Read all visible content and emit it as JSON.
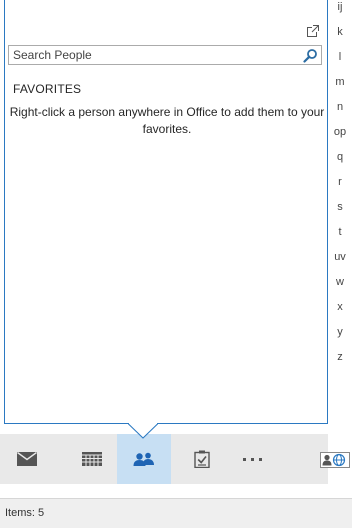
{
  "peek": {
    "search": {
      "placeholder": "Search People",
      "value": ""
    },
    "favorites_heading": "FAVORITES",
    "favorites_message": "Right-click a person anywhere in Office to add them to your favorites."
  },
  "alphabet_index": [
    "ij",
    "k",
    "l",
    "m",
    "n",
    "op",
    "q",
    "r",
    "s",
    "t",
    "uv",
    "w",
    "x",
    "y",
    "z"
  ],
  "navbar": {
    "items": [
      {
        "name": "mail",
        "icon": "envelope-icon"
      },
      {
        "name": "calendar",
        "icon": "calendar-icon"
      },
      {
        "name": "people",
        "icon": "people-icon",
        "active": true
      },
      {
        "name": "tasks",
        "icon": "tasks-icon"
      },
      {
        "name": "more",
        "icon": "ellipsis-icon"
      }
    ]
  },
  "status": {
    "items_text": "Items: 5"
  },
  "colors": {
    "accent": "#2b79c2",
    "active_tab": "#c7dff3",
    "navbar_bg": "#e9e9e9",
    "statusbar_bg": "#efefef"
  }
}
